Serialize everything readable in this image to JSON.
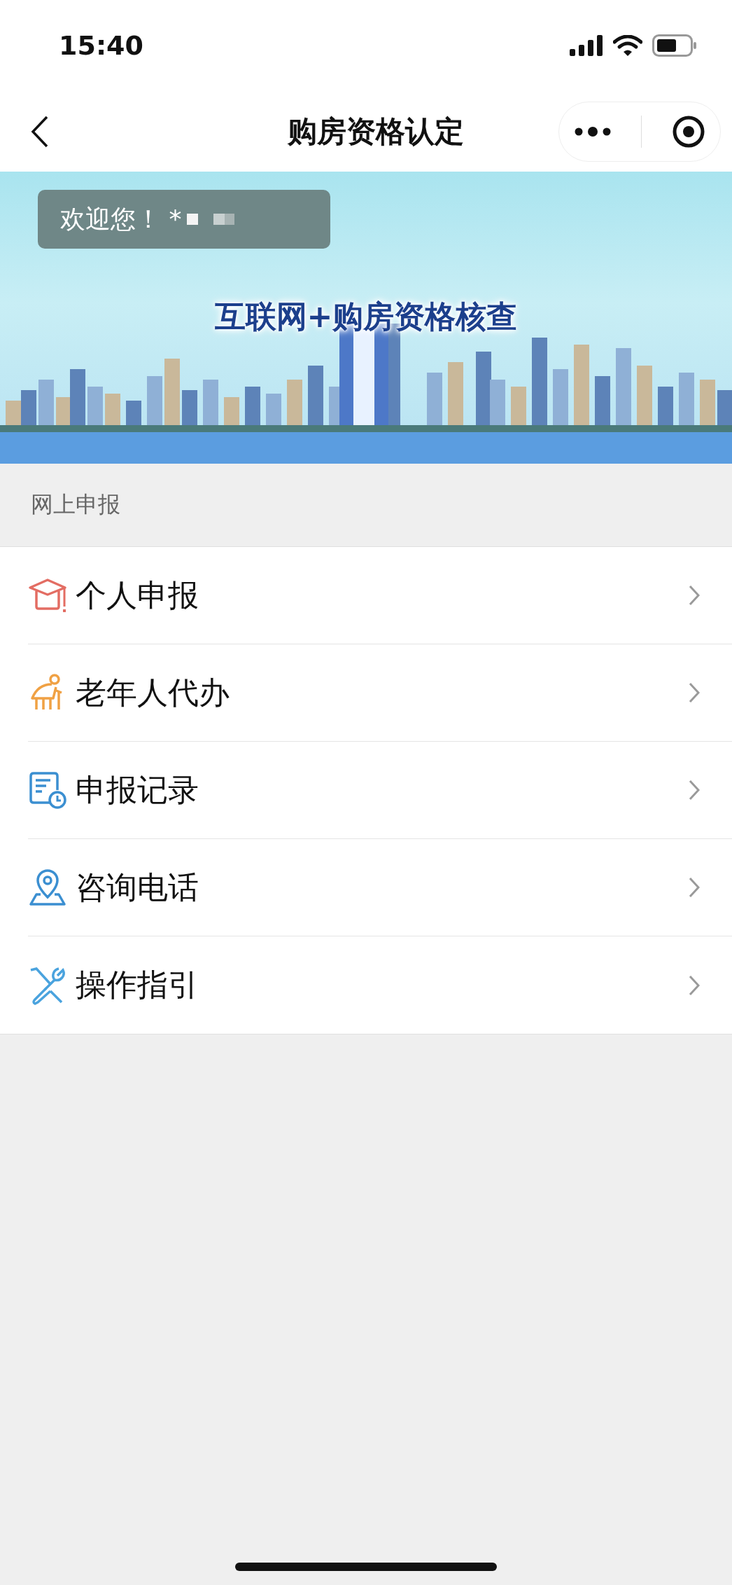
{
  "status_bar": {
    "time": "15:40"
  },
  "nav_bar": {
    "title": "购房资格认定"
  },
  "banner": {
    "welcome": "欢迎您！ *",
    "headline": "互联网+购房资格核查"
  },
  "section": {
    "title": "网上申报"
  },
  "menu_items": [
    {
      "kind": "cap",
      "label": "个人申报"
    },
    {
      "kind": "elder",
      "label": "老年人代办"
    },
    {
      "kind": "record",
      "label": "申报记录"
    },
    {
      "kind": "location",
      "label": "咨询电话"
    },
    {
      "kind": "tools",
      "label": "操作指引"
    }
  ]
}
